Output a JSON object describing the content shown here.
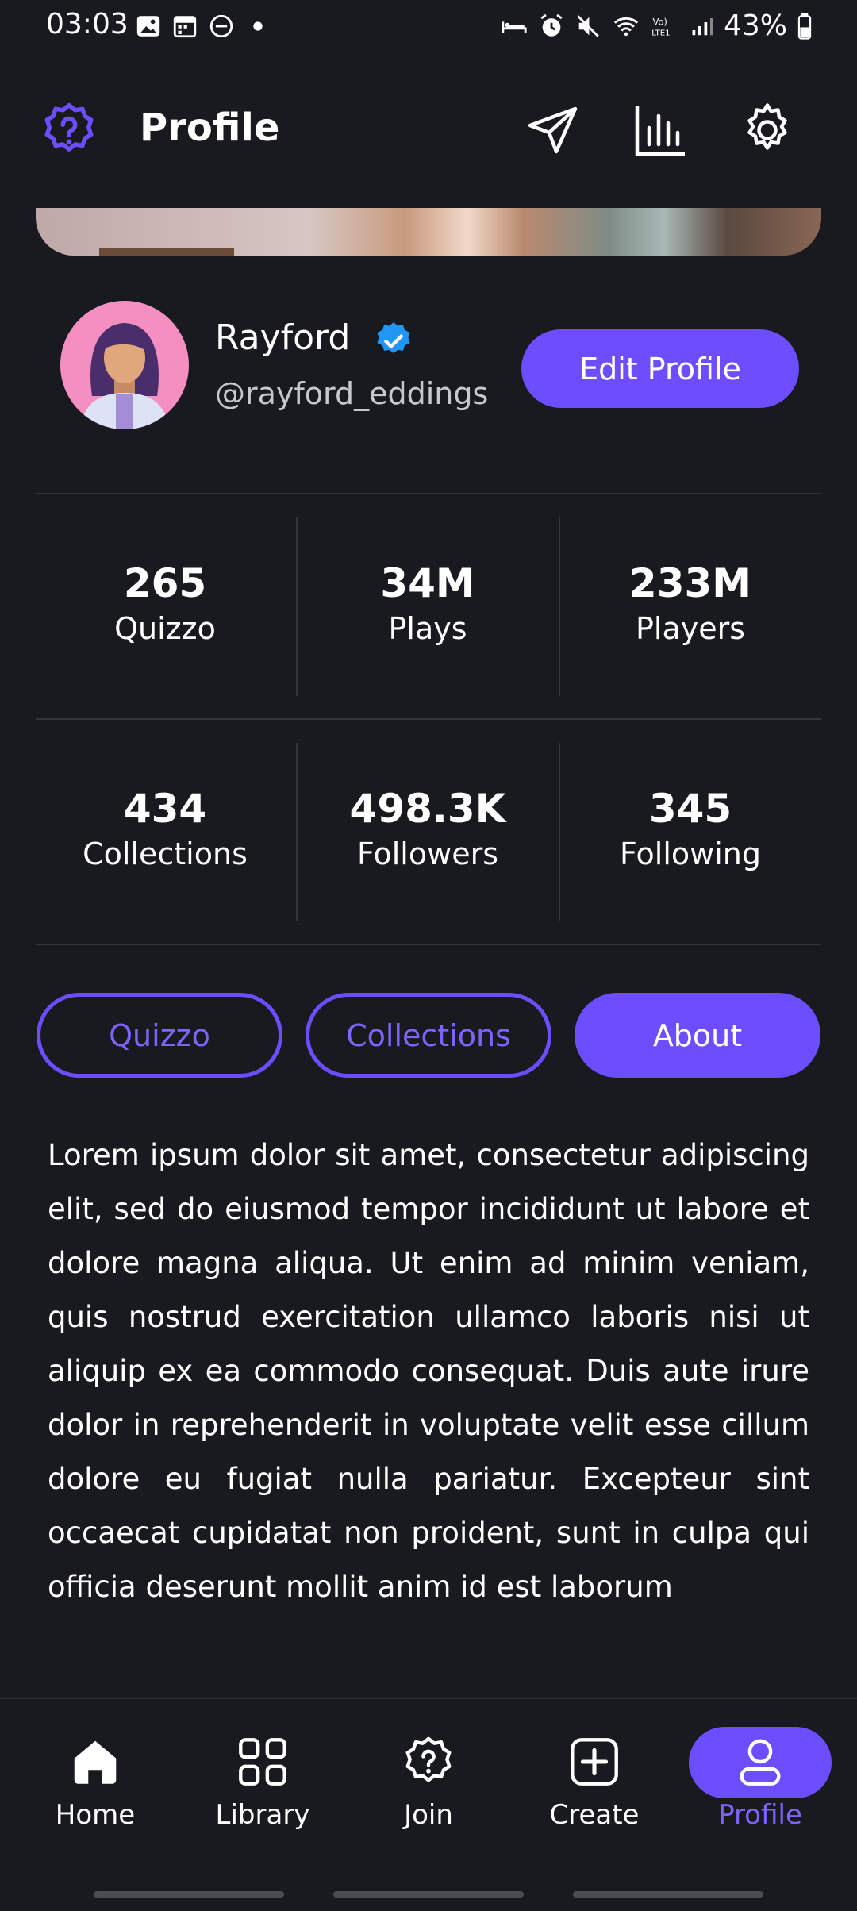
{
  "status_bar": {
    "time": "03:03",
    "battery": "43%",
    "icons_left": [
      "image-icon",
      "calendar-icon",
      "dnd-icon",
      "dot-icon"
    ],
    "icons_right": [
      "bed-icon",
      "alarm-icon",
      "mute-icon",
      "wifi-icon",
      "volte-icon",
      "signal-icon",
      "battery-icon"
    ]
  },
  "header": {
    "title": "Profile",
    "icons": [
      "send-icon",
      "stats-icon",
      "settings-icon"
    ]
  },
  "profile": {
    "name": "Rayford",
    "handle": "@rayford_eddings",
    "edit_label": "Edit Profile"
  },
  "stats": [
    {
      "value": "265",
      "label": "Quizzo"
    },
    {
      "value": "34M",
      "label": "Plays"
    },
    {
      "value": "233M",
      "label": "Players"
    },
    {
      "value": "434",
      "label": "Collections"
    },
    {
      "value": "498.3K",
      "label": "Followers"
    },
    {
      "value": "345",
      "label": "Following"
    }
  ],
  "tabs": [
    {
      "label": "Quizzo",
      "active": false
    },
    {
      "label": "Collections",
      "active": false
    },
    {
      "label": "About",
      "active": true
    }
  ],
  "about": {
    "text": "Lorem ipsum dolor sit amet, consectetur adipiscing elit, sed do eiusmod tempor incididunt ut labore et dolore magna aliqua. Ut enim ad minim veniam, quis nostrud exercitation ullamco laboris nisi ut aliquip ex ea commodo consequat. Duis aute irure dolor in reprehenderit in voluptate velit esse cillum dolore eu fugiat nulla pariatur. Excepteur sint occaecat cupidatat non proident, sunt in culpa qui officia deserunt mollit anim id est laborum"
  },
  "nav": [
    {
      "label": "Home",
      "icon": "home-icon",
      "active": false
    },
    {
      "label": "Library",
      "icon": "grid-icon",
      "active": false
    },
    {
      "label": "Join",
      "icon": "join-icon",
      "active": false
    },
    {
      "label": "Create",
      "icon": "plus-square-icon",
      "active": false
    },
    {
      "label": "Profile",
      "icon": "user-icon",
      "active": true
    }
  ],
  "colors": {
    "background": "#181a20",
    "accent": "#6c4dff",
    "divider": "#33353d",
    "verified": "#2196f3"
  }
}
